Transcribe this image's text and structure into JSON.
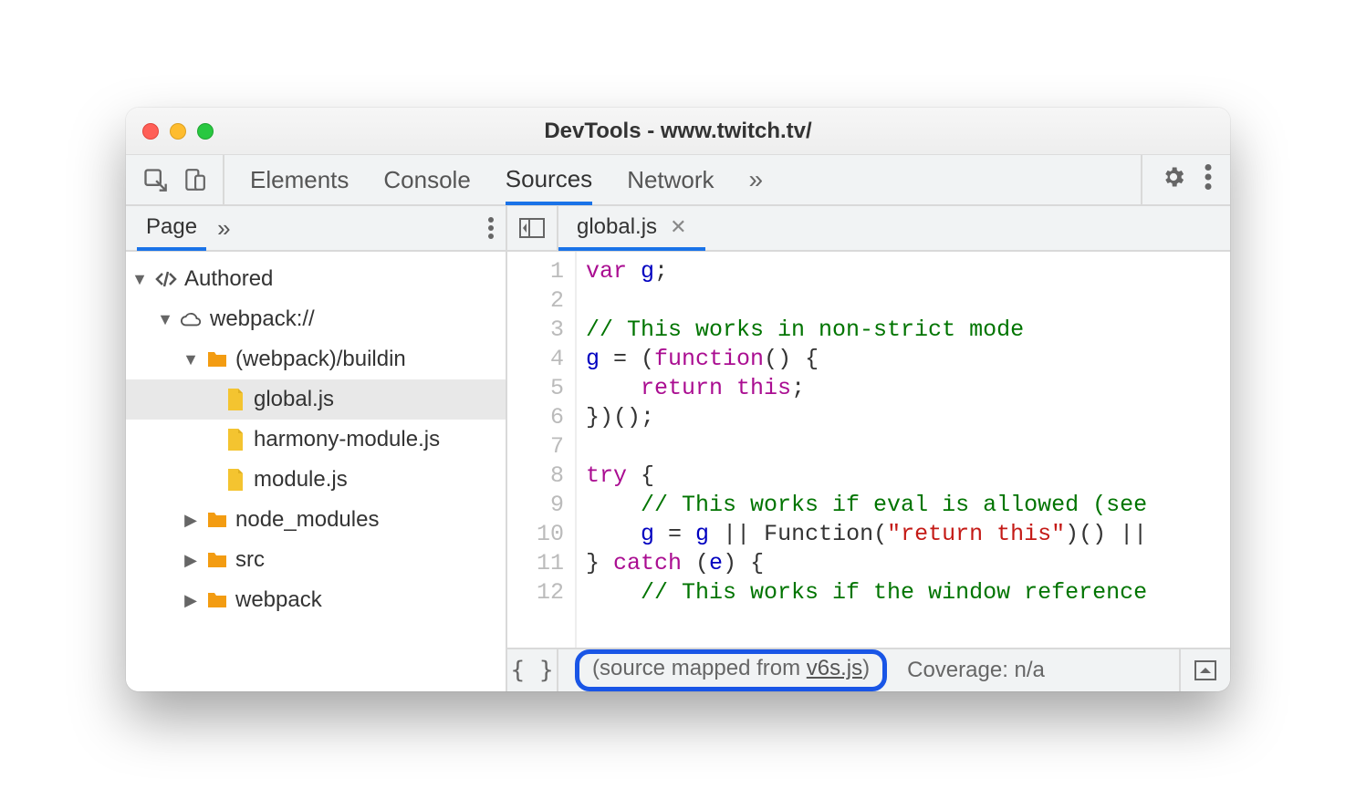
{
  "window": {
    "title": "DevTools - www.twitch.tv/"
  },
  "toolbar": {
    "tabs": [
      "Elements",
      "Console",
      "Sources",
      "Network"
    ],
    "active_index": 2,
    "more": "»"
  },
  "navigator": {
    "tabs": [
      "Page"
    ],
    "active_index": 0,
    "more": "»"
  },
  "open_file_tab": {
    "name": "global.js"
  },
  "tree": {
    "root": "Authored",
    "webpack": "webpack://",
    "buildin": "(webpack)/buildin",
    "files": [
      "global.js",
      "harmony-module.js",
      "module.js"
    ],
    "folders": [
      "node_modules",
      "src",
      "webpack"
    ],
    "selected": "global.js"
  },
  "code": {
    "lines": [
      {
        "n": 1,
        "html": "<span class='kw'>var</span> <span class='id'>g</span>;"
      },
      {
        "n": 2,
        "html": ""
      },
      {
        "n": 3,
        "html": "<span class='cm'>// This works in non-strict mode</span>"
      },
      {
        "n": 4,
        "html": "<span class='id'>g</span> = (<span class='fn'>function</span>() {"
      },
      {
        "n": 5,
        "html": "    <span class='kw'>return</span> <span class='this'>this</span>;"
      },
      {
        "n": 6,
        "html": "})();"
      },
      {
        "n": 7,
        "html": ""
      },
      {
        "n": 8,
        "html": "<span class='kw'>try</span> {"
      },
      {
        "n": 9,
        "html": "    <span class='cm'>// This works if eval is allowed (see</span>"
      },
      {
        "n": 10,
        "html": "    <span class='id'>g</span> = <span class='id'>g</span> || Function(<span class='str'>\"return this\"</span>)() ||"
      },
      {
        "n": 11,
        "html": "} <span class='kw'>catch</span> (<span class='id'>e</span>) {"
      },
      {
        "n": 12,
        "html": "    <span class='cm'>// This works if the window reference</span>"
      }
    ]
  },
  "status": {
    "source_mapped_prefix": "(source mapped from ",
    "source_mapped_link": "v6s.js",
    "source_mapped_suffix": ")",
    "coverage": "Coverage: n/a"
  }
}
